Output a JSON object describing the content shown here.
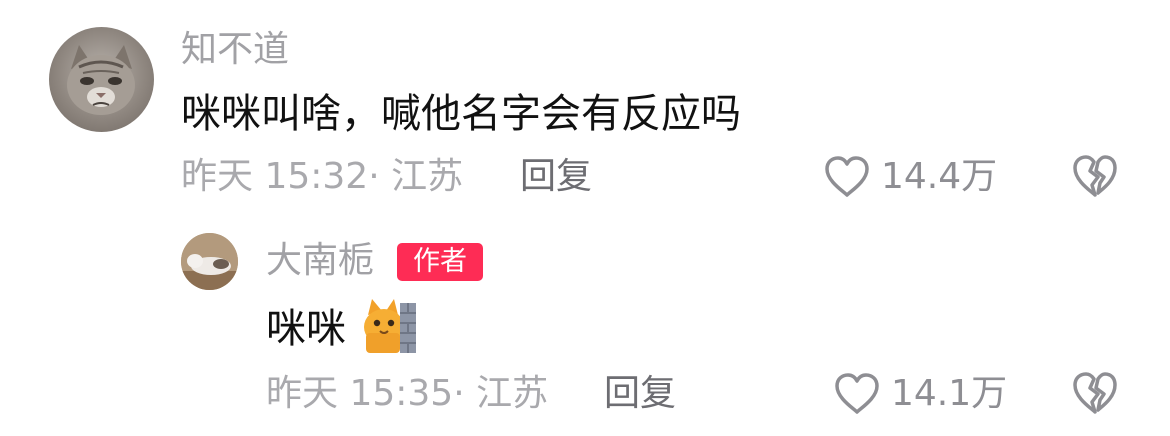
{
  "comments": [
    {
      "username": "知不道",
      "content": "咪咪叫啥，喊他名字会有反应吗",
      "time": "昨天 15:32",
      "location": "江苏",
      "reply_label": "回复",
      "likes": "14.4万",
      "avatar_icon": "cat-face-avatar"
    },
    {
      "username": "大南栀",
      "badge": "作者",
      "content": "咪咪",
      "emoji_icon": "cat-peeking-behind-wall-emoji",
      "time": "昨天 15:35",
      "location": "江苏",
      "reply_label": "回复",
      "likes": "14.1万",
      "avatar_icon": "lying-cat-avatar"
    }
  ],
  "colors": {
    "badge": "#fe2c55",
    "meta": "#a9a9ad",
    "text": "#111111"
  }
}
